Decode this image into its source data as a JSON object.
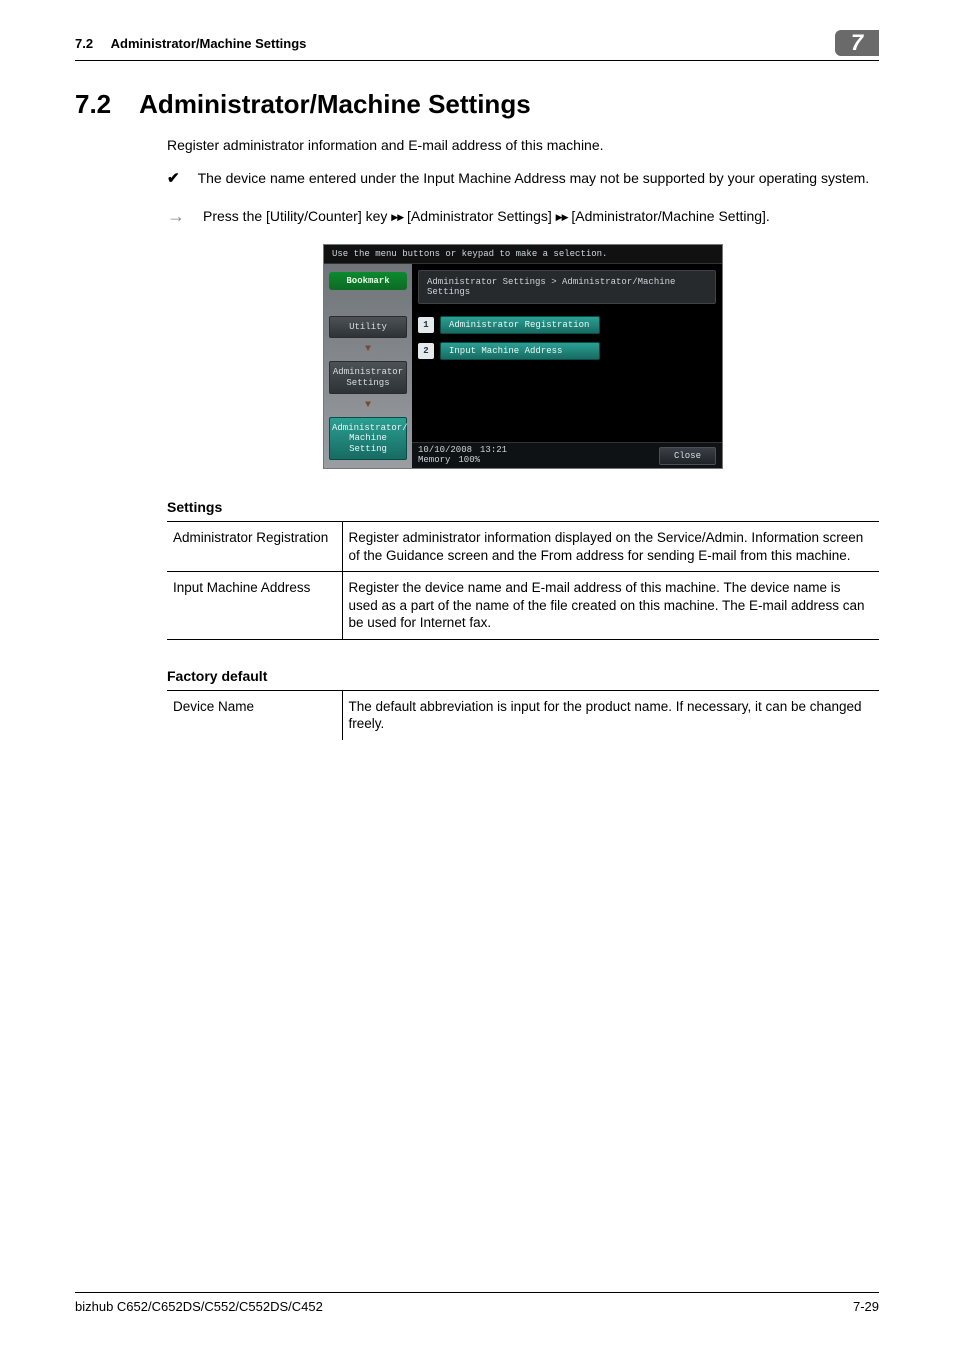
{
  "header": {
    "section_num": "7.2",
    "section_name": "Administrator/Machine Settings",
    "tab_num": "7"
  },
  "title": {
    "num": "7.2",
    "text": "Administrator/Machine Settings"
  },
  "intro": "Register administrator information and E-mail address of this machine.",
  "note": "The device name entered under the Input Machine Address may not be supported by your operating system.",
  "step": {
    "pre": "Press the [Utility/Counter] key ",
    "mid1": " [Administrator Settings] ",
    "mid2": " [Administrator/Machine Setting]."
  },
  "shot": {
    "top": "Use the menu buttons or keypad to make a selection.",
    "bookmark": "Bookmark",
    "nav1": "Utility",
    "nav2": "Administrator Settings",
    "nav3": "Administrator/ Machine Setting",
    "crumb": "Administrator Settings > Administrator/Machine Settings",
    "opt1_num": "1",
    "opt1": "Administrator Registration",
    "opt2_num": "2",
    "opt2": "Input Machine Address",
    "date": "10/10/2008",
    "time": "13:21",
    "mem_label": "Memory",
    "mem_val": "100%",
    "close": "Close"
  },
  "settings": {
    "title": "Settings",
    "rows": [
      {
        "k": "Administrator Registration",
        "v": "Register administrator information displayed on the Service/Admin. Information screen of the Guidance screen and the From address for sending E-mail from this machine."
      },
      {
        "k": "Input Machine Address",
        "v": "Register the device name and E-mail address of this machine. The device name is used as a part of the name of the file created on this machine. The E-mail address can be used for Internet fax."
      }
    ]
  },
  "factory": {
    "title": "Factory default",
    "rows": [
      {
        "k": "Device Name",
        "v": "The default abbreviation is input for the product name. If necessary, it can be changed freely."
      }
    ]
  },
  "footer": {
    "left": "bizhub C652/C652DS/C552/C552DS/C452",
    "right": "7-29"
  }
}
